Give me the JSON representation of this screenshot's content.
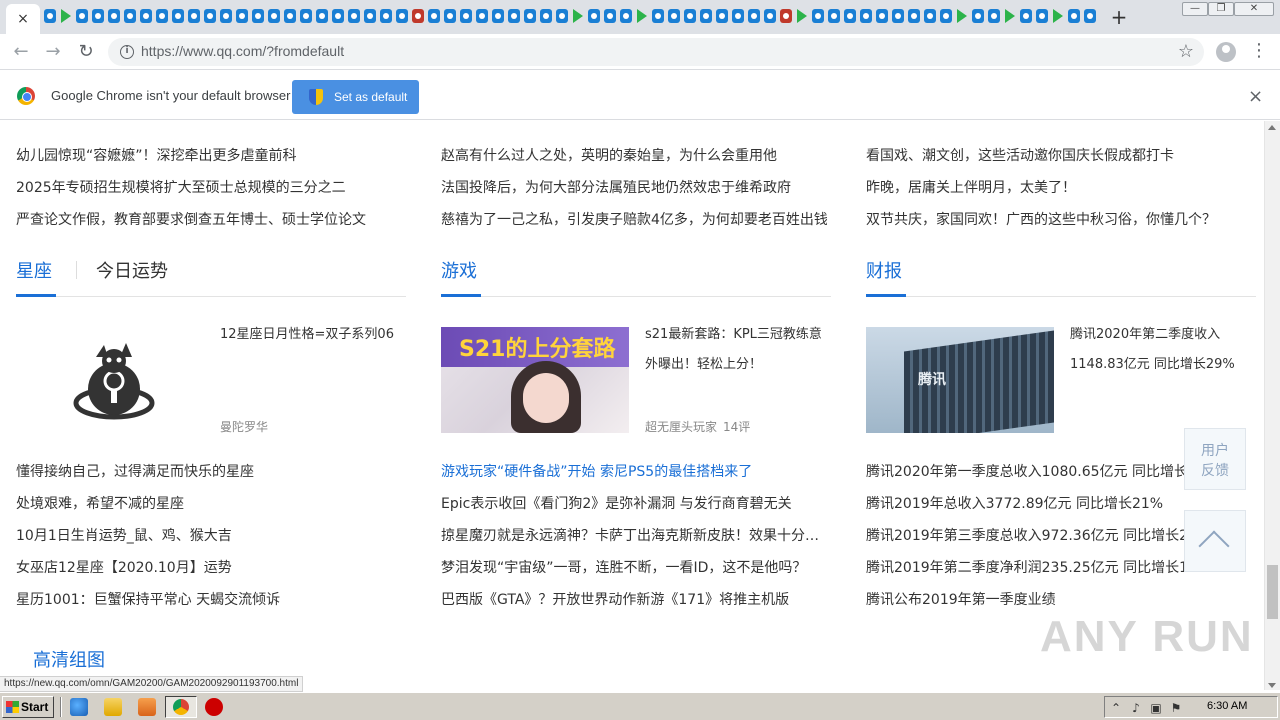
{
  "browser": {
    "active_tab_close": "×",
    "new_tab": "+",
    "window_controls": {
      "minimize": "—",
      "maximize": "❐",
      "close": "✕"
    },
    "url": "https://www.qq.com/?fromdefault",
    "back": "←",
    "forward": "→",
    "reload": "↻",
    "star": "☆",
    "menu": "⋮",
    "infobar": {
      "message": "Google Chrome isn't your default browser",
      "button": "Set as default",
      "close": "×"
    },
    "status_url": "https://new.qq.com/omn/GAM20200/GAM2020092901193700.html"
  },
  "columns": [
    {
      "news_top": [
        "幼儿园惊现“容嬷嬷”！深挖牵出更多虐童前科",
        "2025年专硕招生规模将扩大至硕士总规模的三分之二",
        "严查论文作假，教育部要求倒查五年博士、硕士学位论文"
      ],
      "section_title": "星座",
      "section_tab2": "今日运势",
      "feature_caption": "12星座日月性格=双子系列06",
      "feature_meta": "曼陀罗华",
      "list": [
        "懂得接纳自己，过得满足而快乐的星座",
        "处境艰难，希望不减的星座",
        "10月1日生肖运势_鼠、鸡、猴大吉",
        "女巫店12星座【2020.10月】运势",
        "星历1001：巨蟹保持平常心 天蝎交流倾诉"
      ],
      "bottom_title": "高清组图"
    },
    {
      "news_top": [
        "赵高有什么过人之处，英明的秦始皇，为什么会重用他",
        "法国投降后，为何大部分法属殖民地仍然效忠于维希政府",
        "慈禧为了一己之私，引发庚子赔款4亿多，为何却要老百姓出钱"
      ],
      "section_title": "游戏",
      "thumb_text": "S21的上分套路",
      "feature_caption_1": "s21最新套路：KPL三冠教练意",
      "feature_caption_2": "外曝出！轻松上分！",
      "feature_meta": "超无厘头玩家",
      "feature_comments": "14评",
      "list_highlight": "游戏玩家“硬件备战”开始 索尼PS5的最佳搭档来了",
      "list": [
        "Epic表示收回《看门狗2》是弥补漏洞 与发行商育碧无关",
        "掠星魔刃就是永远滴神？卡萨丁出海克斯新皮肤！效果十分…",
        "梦泪发现“宇宙级”一哥，连胜不断，一看ID，这不是他吗？",
        "巴西版《GTA》？开放世界动作新游《171》将推主机版"
      ]
    },
    {
      "news_top": [
        "看国戏、潮文创，这些活动邀你国庆长假成都打卡",
        "昨晚，居庸关上伴明月，太美了！",
        "双节共庆，家国同欢！广西的这些中秋习俗，你懂几个？"
      ],
      "section_title": "财报",
      "feature_caption_1": "腾讯2020年第二季度收入",
      "feature_caption_2": "1148.83亿元 同比增长29%",
      "building_sign": "腾讯",
      "list": [
        "腾讯2020年第一季度总收入1080.65亿元 同比增长26%",
        "腾讯2019年总收入3772.89亿元 同比增长21%",
        "腾讯2019年第三季度总收入972.36亿元 同比增长21%",
        "腾讯2019年第二季度净利润235.25亿元 同比增长19%",
        "腾讯公布2019年第一季度业绩"
      ]
    }
  ],
  "side": {
    "feedback_line1": "用户",
    "feedback_line2": "反馈"
  },
  "watermark": "ANY RUN",
  "taskbar": {
    "start": "Start",
    "clock": "6:30 AM"
  },
  "colors": {
    "link_blue": "#1a6fd6",
    "chrome_tabstrip": "#dee1e6",
    "infobar_button": "#4a90e2",
    "taskbar": "#d4d0c8"
  }
}
